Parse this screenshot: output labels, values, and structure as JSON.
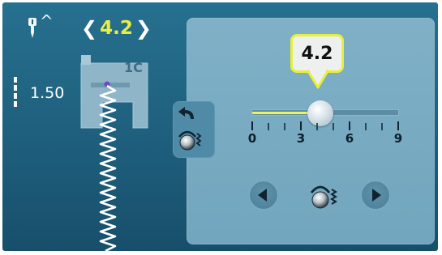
{
  "header": {
    "needle_caret": "^",
    "stitch_value": "4.2",
    "chev_left": "❮",
    "chev_right": "❯"
  },
  "needle_position": {
    "value": "1.50"
  },
  "presser_foot": {
    "label": "1C"
  },
  "setting": {
    "bubble_value": "4.2",
    "slider": {
      "min": 0,
      "max": 9,
      "value": 4.2,
      "tick_labels": [
        "0",
        "3",
        "6",
        "9"
      ]
    }
  },
  "colors": {
    "accent_yellow": "#e9ef3f",
    "background": "#1e5f7d",
    "panel": "#78abc2"
  },
  "icons": {
    "needle": "needle-icon",
    "back": "back-arrow-icon",
    "tension": "thread-tension-icon",
    "prev": "arrow-left-icon",
    "next": "arrow-right-icon"
  }
}
